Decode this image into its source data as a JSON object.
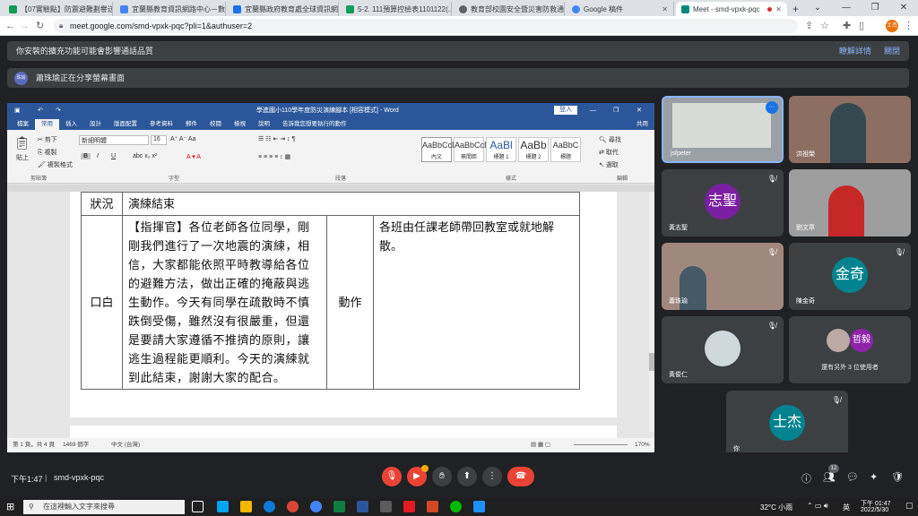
{
  "browser": {
    "tabs": [
      {
        "title": "【07實驗點】防震避難劃譽送",
        "color": "#0f9d58"
      },
      {
        "title": "宜蘭縣教育資訊網路中心－數位",
        "color": "#4285f4"
      },
      {
        "title": "宜蘭縣政府教育處全球資訊網",
        "color": "#1a73e8"
      },
      {
        "title": "5-2. 111預算控檢表1101122(...",
        "color": "#0f9d58"
      },
      {
        "title": "教育部校園安全暨災害防救通報",
        "color": "#5f6368"
      },
      {
        "title": "Google 稿件",
        "color": "#4285f4"
      },
      {
        "title": "Meet - smd-vpxk-pqc",
        "color": "#00897b"
      }
    ],
    "url": "meet.google.com/smd-vpxk-pqc?pli=1&authuser=2",
    "add_tab": "+"
  },
  "banners": {
    "extension_warning": "你安裝的擴充功能可能會影響通話品質",
    "details_link": "瞭解詳情",
    "dismiss_link": "關閉",
    "presenter_avatar": "珠瑜",
    "presenting": "蕭珠瑜正在分享螢幕畫面"
  },
  "word": {
    "title": "學進國小110學年度防災演練腳本 [相容模式] - Word",
    "login": "登入",
    "ribbon_tabs": [
      "檔案",
      "常用",
      "插入",
      "設計",
      "版面配置",
      "參考資料",
      "郵件",
      "校閱",
      "檢視",
      "說明",
      "告訴我您想要執行的動作",
      "共用"
    ],
    "active_tab_index": 1,
    "clipboard": {
      "paste": "貼上",
      "cut": "剪下",
      "copy": "複製",
      "format_painter": "複製格式"
    },
    "font_name": "新細明體",
    "font_size": "16",
    "styles": [
      {
        "sample": "AaBbCcD",
        "name": "內文"
      },
      {
        "sample": "AaBbCcD",
        "name": "無間距"
      },
      {
        "sample": "AaBl",
        "name": "標題 1"
      },
      {
        "sample": "AaBb",
        "name": "標題 2"
      },
      {
        "sample": "AaBbC",
        "name": "標題"
      }
    ],
    "editing": {
      "find": "尋找",
      "replace": "取代",
      "select": "選取"
    },
    "groups": [
      "剪貼簿",
      "字型",
      "段落",
      "樣式",
      "編輯"
    ],
    "table": {
      "row1_label": "狀況",
      "row1_value": "演練結束",
      "row2_label": "口白",
      "row2_text": "【指揮官】各位老師各位同學，剛剛我們進行了一次地震的演練，相信，大家都能依照平時教導給各位的避難方法，做出正確的掩蔽與逃生動作。今天有同學在疏散時不慎跌倒受傷，雖然沒有很嚴重，但還是要請大家遵循不推擠的原則，讓逃生過程能更順利。今天的演練就到此結束，謝謝大家的配合。",
      "row2_action_label": "動作",
      "row2_action": "各班由任課老師帶回教室或就地解散。"
    },
    "status": {
      "page": "第 1 頁，共 4 頁",
      "words": "1469 個字",
      "language": "中文 (台灣)",
      "zoom": "170%"
    }
  },
  "participants": [
    {
      "name": "jsfpeter",
      "type": "video",
      "pinned": true
    },
    {
      "name": "洪祖榮",
      "type": "video"
    },
    {
      "name": "黃志聖",
      "type": "avatar",
      "initials": "志聖",
      "color": "#7b1fa2"
    },
    {
      "name": "劉文章",
      "type": "video"
    },
    {
      "name": "蕭珠瑜",
      "type": "video"
    },
    {
      "name": "陳金奇",
      "type": "avatar",
      "initials": "金奇",
      "color": "#00838f"
    },
    {
      "name": "黃俊仁",
      "type": "video"
    },
    {
      "name": "還有另外 3 位使用者",
      "type": "group",
      "initials": "哲毅",
      "color": "#8e24aa"
    },
    {
      "name": "你",
      "type": "avatar",
      "initials": "士杰",
      "color": "#00838f"
    }
  ],
  "meet_bar": {
    "time": "下午1:47",
    "meeting_code": "smd-vpxk-pqc",
    "people_count": "12"
  },
  "taskbar": {
    "search_placeholder": "在這裡輸入文字來搜尋",
    "weather": "32°C 小雨",
    "ime": "英",
    "clock_time": "下午 01:47",
    "clock_date": "2022/5/30"
  }
}
